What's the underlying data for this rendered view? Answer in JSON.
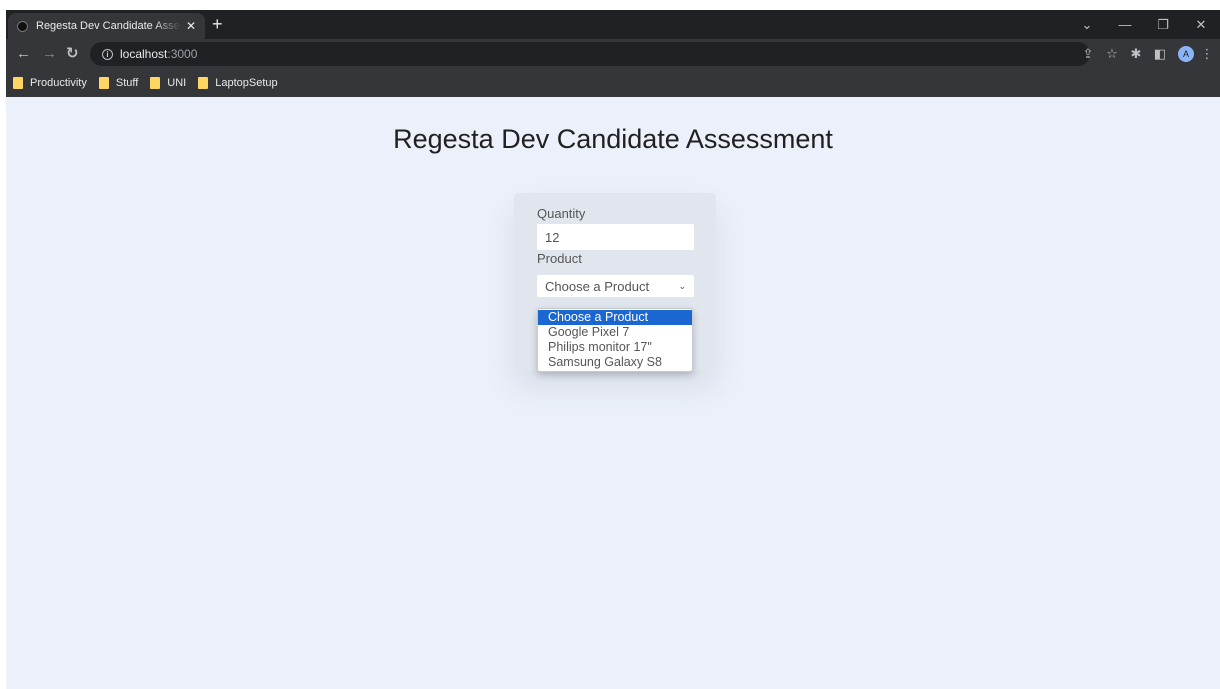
{
  "browser": {
    "tab_title": "Regesta Dev Candidate Assessment",
    "tab_close": "✕",
    "new_tab": "+",
    "url_host": "localhost",
    "url_port": ":3000",
    "bookmarks": [
      {
        "label": "Productivity"
      },
      {
        "label": "Stuff"
      },
      {
        "label": "UNI"
      },
      {
        "label": "LaptopSetup"
      }
    ],
    "profile_initial": "A"
  },
  "page": {
    "title": "Regesta Dev Candidate Assessment",
    "form": {
      "quantity_label": "Quantity",
      "quantity_value": "12",
      "product_label": "Product",
      "product_selected": "Choose a Product",
      "product_options": [
        {
          "label": "Choose a Product"
        },
        {
          "label": "Google Pixel 7"
        },
        {
          "label": "Philips monitor 17\""
        },
        {
          "label": "Samsung Galaxy S8"
        }
      ]
    }
  },
  "colors": {
    "page_background": "#ebf0fa",
    "card_background": "#e1e6ee",
    "option_highlight": "#1a67d2",
    "chrome_dark": "#202124",
    "chrome_toolbar": "#35363a",
    "bookmark_folder": "#fdd663"
  },
  "icons": {
    "back": "arrow-left-icon",
    "forward": "arrow-right-icon",
    "reload": "reload-icon",
    "site_info": "info-icon",
    "share": "share-icon",
    "bookmark_star": "star-icon",
    "extensions": "puzzle-icon",
    "side_panel": "side-panel-icon",
    "menu": "kebab-menu-icon",
    "select_chevron": "chevron-down-icon"
  }
}
